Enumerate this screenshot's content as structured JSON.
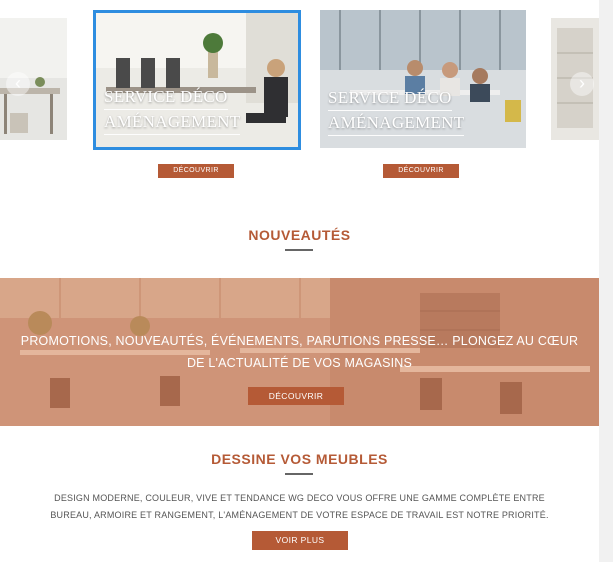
{
  "carousel": {
    "slides": [
      {
        "title_line1": "SERVICE DÉCO",
        "title_line2": "AMÉNAGEMENT",
        "button": "DÉCOUVRIR"
      },
      {
        "title_line1": "SERVICE DÉCO",
        "title_line2": "AMÉNAGEMENT",
        "button": "DÉCOUVRIR"
      }
    ],
    "prev_icon": "‹",
    "next_icon": "›"
  },
  "nouveautes": {
    "title": "NOUVEAUTÉS",
    "banner_line1": "PROMOTIONS, NOUVEAUTÉS, ÉVÉNEMENTS, PARUTIONS PRESSE… PLONGEZ AU CŒUR",
    "banner_line2": "DE L'ACTUALITÉ DE VOS MAGASINS",
    "button": "DÉCOUVRIR"
  },
  "dessine": {
    "title": "DESSINE VOS MEUBLES",
    "text_line1": "DESIGN MODERNE, COULEUR, VIVE ET TENDANCE WG DECO VOUS OFFRE UNE GAMME COMPLÈTE ENTRE",
    "text_line2": "BUREAU, ARMOIRE  ET RANGEMENT, L'AMÉNAGEMENT DE VOTRE ESPACE DE TRAVAIL EST NOTRE PRIORITÉ.",
    "button": "VOIR PLUS"
  },
  "colors": {
    "accent": "#b55a36",
    "selection": "#2e8de0"
  }
}
